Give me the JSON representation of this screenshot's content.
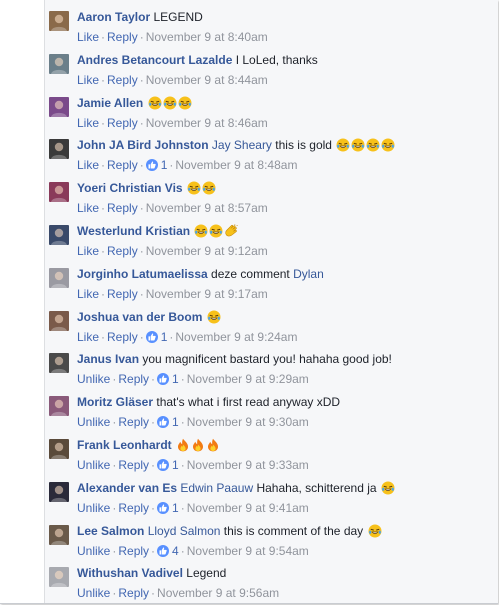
{
  "comments": [
    {
      "author": "Aaron Taylor",
      "mention": "",
      "text": "LEGEND",
      "emojis": [],
      "like": "Like",
      "reply": "Reply",
      "count": "",
      "time": "November 9 at 8:40am",
      "avatar": "#8a6a4a"
    },
    {
      "author": "Andres Betancourt Lazalde",
      "mention": "",
      "text": "I LoLed, thanks",
      "emojis": [],
      "like": "Like",
      "reply": "Reply",
      "count": "",
      "time": "November 9 at 8:44am",
      "avatar": "#6b7f8a"
    },
    {
      "author": "Jamie Allen",
      "mention": "",
      "text": "",
      "emojis": [
        "laugh",
        "laugh",
        "laugh"
      ],
      "like": "Like",
      "reply": "Reply",
      "count": "",
      "time": "November 9 at 8:46am",
      "avatar": "#7a4a8a"
    },
    {
      "author": "John JA Bird Johnston",
      "mention": "Jay Sheary",
      "text": "this is gold",
      "emojis": [
        "laugh",
        "laugh",
        "laugh",
        "laugh"
      ],
      "like": "Like",
      "reply": "Reply",
      "count": "1",
      "time": "November 9 at 8:48am",
      "avatar": "#3a3a3a"
    },
    {
      "author": "Yoeri Christian Vis",
      "mention": "",
      "text": "",
      "emojis": [
        "laugh",
        "laugh"
      ],
      "like": "Like",
      "reply": "Reply",
      "count": "",
      "time": "November 9 at 8:57am",
      "avatar": "#8a3a5a"
    },
    {
      "author": "Westerlund Kristian",
      "mention": "",
      "text": "",
      "emojis": [
        "laugh",
        "laugh",
        "clap"
      ],
      "like": "Like",
      "reply": "Reply",
      "count": "",
      "time": "November 9 at 9:12am",
      "avatar": "#3a4a6a"
    },
    {
      "author": "Jorginho Latumaelissa",
      "mention": "",
      "text": "deze comment",
      "mention2": "Dylan",
      "emojis": [],
      "like": "Like",
      "reply": "Reply",
      "count": "",
      "time": "November 9 at 9:17am",
      "avatar": "#9a9aa2"
    },
    {
      "author": "Joshua van der Boom",
      "mention": "",
      "text": "",
      "emojis": [
        "laugh"
      ],
      "like": "Like",
      "reply": "Reply",
      "count": "1",
      "time": "November 9 at 9:24am",
      "avatar": "#7a5a4a"
    },
    {
      "author": "Janus Ivan",
      "mention": "",
      "text": "you magnificent bastard you! hahaha good job!",
      "emojis": [],
      "like": "Unlike",
      "reply": "Reply",
      "count": "1",
      "time": "November 9 at 9:29am",
      "avatar": "#4a4a4a"
    },
    {
      "author": "Moritz Gläser",
      "mention": "",
      "text": "that's what i first read anyway xDD",
      "emojis": [],
      "like": "Unlike",
      "reply": "Reply",
      "count": "1",
      "time": "November 9 at 9:30am",
      "avatar": "#8a5a7a"
    },
    {
      "author": "Frank Leonhardt",
      "mention": "",
      "text": "",
      "emojis": [
        "fire",
        "fire",
        "fire"
      ],
      "like": "Unlike",
      "reply": "Reply",
      "count": "1",
      "time": "November 9 at 9:33am",
      "avatar": "#5a4a3a"
    },
    {
      "author": "Alexander van Es",
      "mention": "Edwin Paauw",
      "text": "Hahaha, schitterend ja",
      "emojis": [
        "laugh"
      ],
      "like": "Unlike",
      "reply": "Reply",
      "count": "1",
      "time": "November 9 at 9:41am",
      "avatar": "#2a2a3a"
    },
    {
      "author": "Lee Salmon",
      "mention": "Lloyd Salmon",
      "text": "this is comment of the day",
      "emojis": [
        "laugh"
      ],
      "like": "Unlike",
      "reply": "Reply",
      "count": "4",
      "time": "November 9 at 9:54am",
      "avatar": "#6a5a4a"
    },
    {
      "author": "Withushan Vadivel",
      "mention": "",
      "text": "Legend",
      "emojis": [],
      "like": "Unlike",
      "reply": "Reply",
      "count": "",
      "time": "November 9 at 9:56am",
      "avatar": "#a8aab0"
    }
  ],
  "colors": {
    "link": "#365899",
    "action": "#4267b2",
    "meta": "#90949c",
    "like_badge": "#5890ff"
  },
  "icons": {
    "laugh": "laughing-face-emoji",
    "fire": "fire-emoji",
    "clap": "clapping-hands-emoji",
    "like": "thumbs-up-icon"
  }
}
